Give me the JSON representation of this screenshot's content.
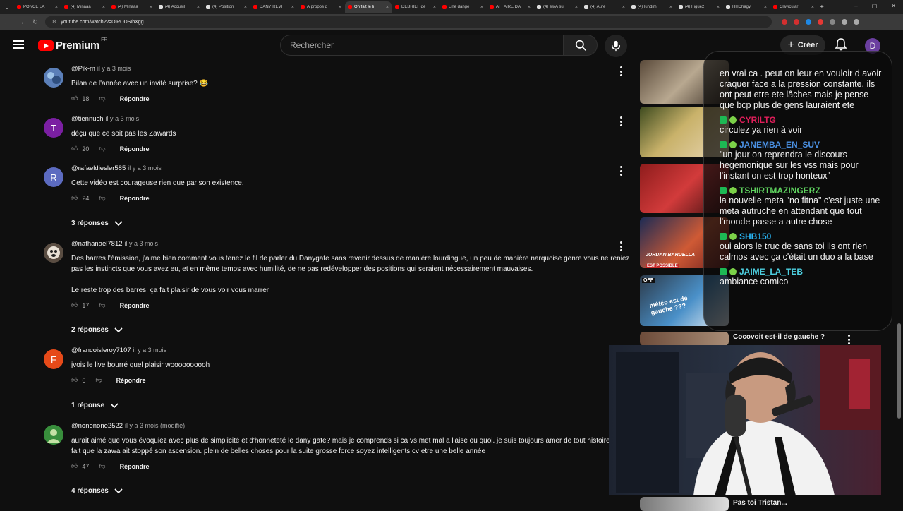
{
  "browser": {
    "tabs": [
      {
        "label": "PONCE LA",
        "color": "#ff0000"
      },
      {
        "label": "(4) Minaaa",
        "color": "#ff0000"
      },
      {
        "label": "(4) Minaaa",
        "color": "#ff0000"
      },
      {
        "label": "(4) Accueil",
        "color": "#dddddd"
      },
      {
        "label": "(4) Position",
        "color": "#dddddd"
      },
      {
        "label": "DANY REVI",
        "color": "#ff0000"
      },
      {
        "label": "À propos d",
        "color": "#ff0000"
      },
      {
        "label": "On fait le li",
        "color": "#ff0000"
      },
      {
        "label": "DÉBRIEF de",
        "color": "#ff0000"
      },
      {
        "label": "Une dange",
        "color": "#ff0000"
      },
      {
        "label": "AFFAIRE DA",
        "color": "#ff0000"
      },
      {
        "label": "(4) eloA su",
        "color": "#dddddd"
      },
      {
        "label": "(4) Aure",
        "color": "#dddddd"
      },
      {
        "label": "(4) lundim",
        "color": "#dddddd"
      },
      {
        "label": "(4) Figue2",
        "color": "#dddddd"
      },
      {
        "label": "HHChagy",
        "color": "#dddddd"
      },
      {
        "label": "Clavicular",
        "color": "#ff0000"
      }
    ],
    "active_tab": 7,
    "url": "youtube.com/watch?v=OiRODSIbXgg"
  },
  "header": {
    "logo_text": "Premium",
    "country": "FR",
    "search_placeholder": "Rechercher",
    "create_label": "Créer",
    "avatar_letter": "D"
  },
  "comments": [
    {
      "author": "@Pik-m",
      "time": "il y a 3 mois",
      "text": "Bilan de l'année avec un invité surprise? 😂",
      "likes": "18",
      "reply": "Répondre",
      "avatar": "img",
      "avatar_color": "#4a6fa5"
    },
    {
      "author": "@tiennuch",
      "time": "il y a 3 mois",
      "text": "déçu que ce soit pas les Zawards",
      "likes": "20",
      "reply": "Répondre",
      "avatar": "T",
      "avatar_color": "#7b1fa2"
    },
    {
      "author": "@rafaeldiesler585",
      "time": "il y a 3 mois",
      "text": "Cette vidéo est courageuse rien que par son existence.",
      "likes": "24",
      "reply": "Répondre",
      "avatar": "R",
      "avatar_color": "#5c6bc0",
      "replies": "3 réponses"
    },
    {
      "author": "@nathanael7812",
      "time": "il y a 3 mois",
      "text": "Des barres l'émission, j'aime bien comment vous tenez le fil de parler du Danygate sans revenir dessus de manière lourdingue, un peu de manière narquoise genre vous ne reniez pas les instincts que vous avez eu, et en même temps avec humilité, de ne pas redévelopper des positions qui seraient nécessairement mauvaises.",
      "text2": "Le reste trop des barres, ça fait plaisir de vous voir vous marrer",
      "likes": "17",
      "reply": "Répondre",
      "avatar": "img",
      "avatar_color": "#6d5f52",
      "replies": "2 réponses"
    },
    {
      "author": "@francoisleroy7107",
      "time": "il y a 3 mois",
      "text": "jvois le live bourré quel plaisir woooooooooh",
      "likes": "6",
      "reply": "Répondre",
      "avatar": "F",
      "avatar_color": "#e64a19",
      "replies": "1 réponse"
    },
    {
      "author": "@nonenone2522",
      "time": "il y a 3 mois (modifié)",
      "text": "aurait aimé que vous évoquiez avec plus de simplicité et d'honneteté le dany gate? mais je comprends si ca vs met mal a l'aise ou quoi. je suis toujours amer de tout histoire, du fait que la zawa ait stoppé son ascension. plein de belles choses pour la suite grosse force soyez intelligents cv etre une belle année",
      "likes": "47",
      "reply": "Répondre",
      "avatar": "img",
      "avatar_color": "#43a047",
      "replies": "4 réponses"
    }
  ],
  "sidebar": {
    "videos": [
      {
        "title": "Cocovoit est-il de gauche ?"
      },
      {
        "title": "Pas toi Tristan..."
      }
    ],
    "thumb_texts": [
      "JORDAN BARDELLA",
      "EST POSSIBLE",
      "OFF",
      "météo est de gauche ???"
    ]
  },
  "chat": {
    "messages": [
      {
        "user": "",
        "text": "en vrai ca . peut on leur en vouloir d avoir craquer face a la pression constante. ils ont peut etre ete lâches mais je pense que bcp plus de gens lauraient ete",
        "color": "#ffffff"
      },
      {
        "user": "CYRILTG",
        "text": "circulez ya rien à voir",
        "color": "#e01e5a"
      },
      {
        "user": "JANEMBA_EN_SUV",
        "text": "\"un jour on reprendra le discours hegemonique sur les vss mais pour l'instant on est trop honteux\"",
        "color": "#4a90e2"
      },
      {
        "user": "TSHIRTMAZINGERZ",
        "text": "la nouvelle meta \"no fitna\" c'est juste une meta autruche en attendant que tout l'monde passe a autre chose",
        "color": "#5fd35f"
      },
      {
        "user": "SHB150",
        "text": "oui alors le truc de sans toi ils ont rien calmos avec ça c'était un duo a la base",
        "color": "#29b6f6"
      },
      {
        "user": "JAIME_LA_TEB",
        "text": "ambiance comico",
        "color": "#4dd0e1"
      }
    ]
  }
}
